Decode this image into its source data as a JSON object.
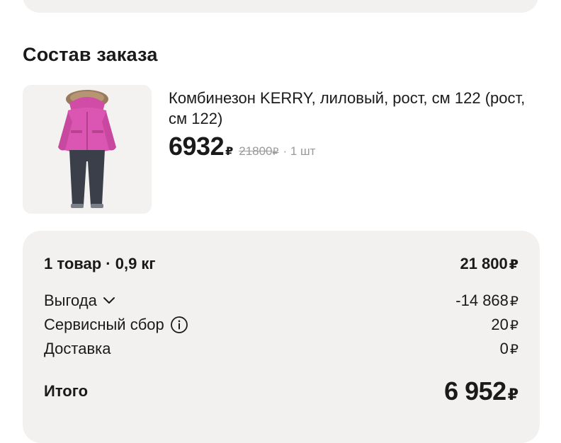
{
  "order": {
    "title": "Состав заказа",
    "item": {
      "name": "Комбинезон KERRY, лиловый, рост, см 122 (рост, см 122)",
      "price": "6932",
      "currency": "₽",
      "old_price": "21800",
      "quantity": "· 1 шт",
      "image_icon": "kids-snowsuit-image"
    }
  },
  "summary": {
    "items_label": "1 товар · 0,9 кг",
    "items_value": "21 800",
    "discount_label": "Выгода",
    "discount_value": "-14 868",
    "service_label": "Сервисный сбор",
    "service_value": "20",
    "delivery_label": "Доставка",
    "delivery_value": "0",
    "total_label": "Итого",
    "total_value": "6 952",
    "currency": "₽"
  },
  "colors": {
    "card_bg": "#f2f1ef",
    "text": "#1a1a1a",
    "muted": "#9a9a9a"
  }
}
